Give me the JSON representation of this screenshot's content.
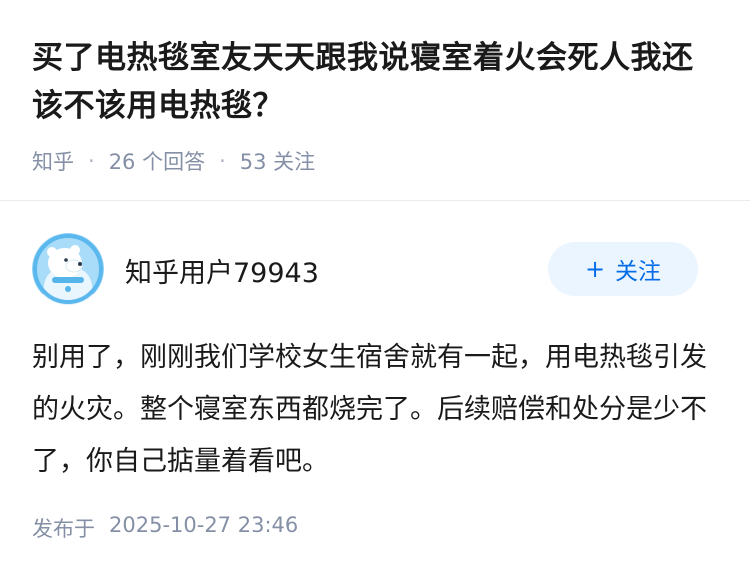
{
  "question": {
    "title": "买了电热毯室友天天跟我说寝室着火会死人我还该不该用电热毯？",
    "source": "知乎",
    "answers_count": "26 个回答",
    "followers_count": "53 关注",
    "separator": "·"
  },
  "author": {
    "name": "知乎用户79943",
    "follow_label": "关注",
    "follow_icon": "+"
  },
  "answer": {
    "content": "别用了，刚刚我们学校女生宿舍就有一起，用电热毯引发的火灾。整个寝室东西都烧完了。后续赔偿和处分是少不了，你自己掂量着看吧。",
    "published_label": "发布于",
    "published_time": "2025-10-27 23:46"
  },
  "colors": {
    "accent": "#056de8",
    "follow_bg": "#ebf5ff",
    "meta": "#8590a6"
  }
}
